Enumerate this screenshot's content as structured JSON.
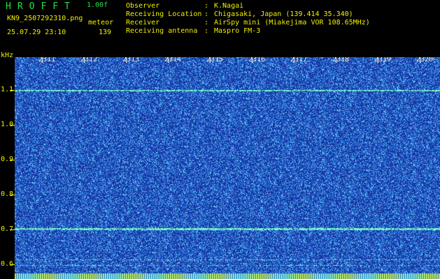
{
  "header": {
    "title": "HROFFT",
    "version": "1.00f",
    "filename": "KN9_2507292310.png",
    "mode": "meteor",
    "datetime": "25.07.29 23:10",
    "count": "139"
  },
  "metadata": [
    {
      "key": "Observer",
      "value": "K.Nagai"
    },
    {
      "key": "Receiving Location",
      "value": "Chigasaki, Japan (139.414 35.340)"
    },
    {
      "key": "Receiver",
      "value": "AirSpy mini (Miakejima VOR 108.65MHz)"
    },
    {
      "key": "Receiving antenna",
      "value": "Maspro FM-3"
    }
  ],
  "axis": {
    "unit": "kHz",
    "freq_labels": [
      "1.1",
      "1.0",
      "0.9",
      "0.8",
      "0.7",
      "0.6"
    ],
    "time_labels": [
      "2311",
      "2312",
      "2313",
      "2314",
      "2315",
      "2316",
      "2317",
      "2318",
      "2319",
      "2320"
    ]
  },
  "colors": {
    "background": "#1a3aa8",
    "noise": "#4fb8ff",
    "signal": "#7fffd0",
    "text_yellow": "#f0f000",
    "text_green": "#22e040"
  }
}
